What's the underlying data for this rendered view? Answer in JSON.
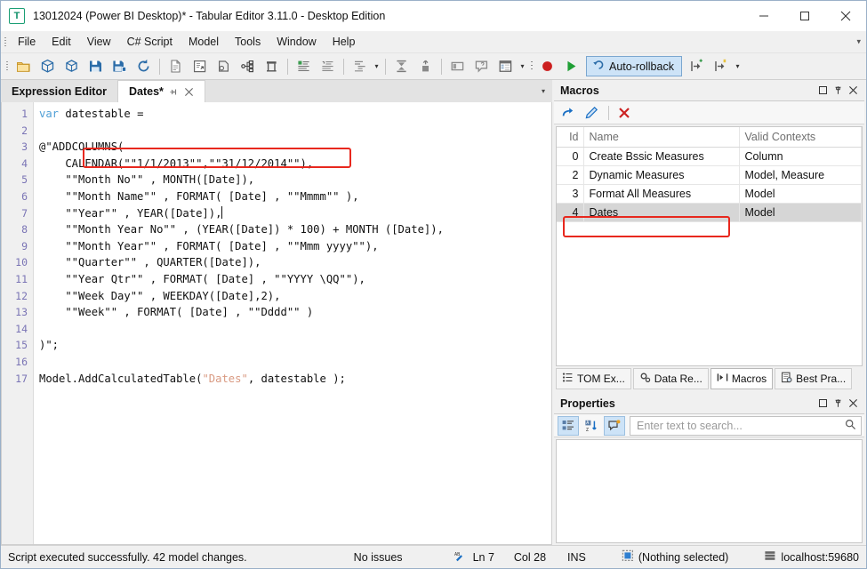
{
  "window": {
    "title": "13012024 (Power BI Desktop)* - Tabular Editor 3.11.0 - Desktop Edition",
    "app_icon": "tabular-editor-icon",
    "minimize_label": "–",
    "maximize_label": "□",
    "close_label": "✕"
  },
  "menubar": {
    "items": [
      {
        "label": "File"
      },
      {
        "label": "Edit"
      },
      {
        "label": "View"
      },
      {
        "label": "C# Script"
      },
      {
        "label": "Model"
      },
      {
        "label": "Tools"
      },
      {
        "label": "Window"
      },
      {
        "label": "Help"
      }
    ],
    "overflow_label": "▾"
  },
  "toolbar": {
    "groups": [
      {
        "buttons": [
          {
            "icon": "open-folder-icon",
            "label": "Open"
          },
          {
            "icon": "cube-open-icon",
            "label": "Open from Database"
          },
          {
            "icon": "cube-icon",
            "label": "Connect"
          },
          {
            "icon": "save-icon",
            "label": "Save"
          },
          {
            "icon": "save-as-icon",
            "label": "Save As"
          },
          {
            "icon": "refresh-icon",
            "label": "Refresh"
          }
        ]
      },
      {
        "buttons": [
          {
            "icon": "new-measure-icon",
            "label": "New Measure"
          },
          {
            "icon": "new-calculated-column-icon",
            "label": "New Calculated Column"
          },
          {
            "icon": "new-calculation-item-icon",
            "label": "New Calculation Item"
          },
          {
            "icon": "new-hierarchy-icon",
            "label": "New Hierarchy"
          },
          {
            "icon": "new-table-icon",
            "label": "New Table"
          }
        ]
      },
      {
        "buttons": [
          {
            "icon": "format-dax-icon",
            "label": "Format DAX"
          },
          {
            "icon": "format-dax-all-icon",
            "label": "Format All DAX"
          }
        ]
      },
      {
        "buttons": [
          {
            "icon": "align-icon",
            "label": "Align"
          }
        ],
        "caret": "▾"
      },
      {
        "buttons": [
          {
            "icon": "deploy-icon",
            "label": "Deploy"
          },
          {
            "icon": "refresh-table-icon",
            "label": "Refresh Table"
          }
        ]
      },
      {
        "buttons": [
          {
            "icon": "preview-icon",
            "label": "Preview Data"
          },
          {
            "icon": "query-icon",
            "label": "New DAX Query"
          },
          {
            "icon": "pivot-grid-icon",
            "label": "Pivot Grid"
          }
        ],
        "caret": "▾"
      },
      {
        "buttons": [
          {
            "icon": "record-macro-icon",
            "label": "Record Macro"
          },
          {
            "icon": "run-script-icon",
            "label": "Run Script"
          }
        ]
      }
    ],
    "rollback": {
      "icon": "undo-arrow-icon",
      "label": "Auto-rollback",
      "active": true
    },
    "step_buttons": [
      {
        "icon": "step-into-icon",
        "label": "Step Into"
      },
      {
        "icon": "step-over-icon",
        "label": "Step Over"
      }
    ],
    "step_caret": "▾"
  },
  "editor": {
    "tabs": [
      {
        "label": "Expression Editor",
        "type": "header",
        "active": false
      },
      {
        "label": "Dates*",
        "type": "document",
        "active": true,
        "pin_icon": "pin-icon",
        "close_icon": "close-icon"
      }
    ],
    "overflow_caret": "▾",
    "line_numbers": [
      1,
      2,
      3,
      4,
      5,
      6,
      7,
      8,
      9,
      10,
      11,
      12,
      13,
      14,
      15,
      16,
      17
    ],
    "lines": [
      "var datestable =",
      "",
      "@\"ADDCOLUMNS(",
      "    CALENDAR(\"\"1/1/2013\"\",\"\"31/12/2014\"\"),",
      "    \"\"Month No\"\" , MONTH([Date]),",
      "    \"\"Month Name\"\" , FORMAT( [Date] , \"\"Mmmm\"\" ),",
      "    \"\"Year\"\" , YEAR([Date]),",
      "    \"\"Month Year No\"\" , (YEAR([Date]) * 100) + MONTH ([Date]),",
      "    \"\"Month Year\"\" , FORMAT( [Date] , \"\"Mmm yyyy\"\"),",
      "    \"\"Quarter\"\" , QUARTER([Date]),",
      "    \"\"Year Qtr\"\" , FORMAT( [Date] , \"\"YYYY \\QQ\"\"),",
      "    \"\"Week Day\"\" , WEEKDAY([Date],2),",
      "    \"\"Week\"\" , FORMAT( [Date] , \"\"Dddd\"\" )",
      "",
      ")\";",
      "",
      "Model.AddCalculatedTable(\"Dates\", datestable );"
    ],
    "highlight_note": "red-annotation-box-around-calendar-call"
  },
  "macros_panel": {
    "title": "Macros",
    "window_buttons": [
      {
        "icon": "restore-icon",
        "label": "□"
      },
      {
        "icon": "pin-icon",
        "label": "⚲"
      },
      {
        "icon": "close-icon",
        "label": "✕"
      }
    ],
    "toolbar": [
      {
        "icon": "run-macro-icon",
        "label": "Run"
      },
      {
        "icon": "edit-macro-icon",
        "label": "Edit"
      },
      {
        "icon": "delete-macro-icon",
        "label": "Delete"
      }
    ],
    "columns": [
      "Id",
      "Name",
      "Valid Contexts"
    ],
    "rows": [
      {
        "id": "0",
        "name": "Create Bssic Measures",
        "contexts": "Column",
        "selected": false
      },
      {
        "id": "2",
        "name": "Dynamic Measures",
        "contexts": "Model, Measure",
        "selected": false
      },
      {
        "id": "3",
        "name": "Format All Measures",
        "contexts": "Model",
        "selected": false
      },
      {
        "id": "4",
        "name": "Dates",
        "contexts": "Model",
        "selected": true
      }
    ],
    "bottom_tabs": [
      {
        "label": "TOM Ex...",
        "icon": "tom-explorer-icon",
        "active": false
      },
      {
        "label": "Data Re...",
        "icon": "data-refresh-icon",
        "active": false
      },
      {
        "label": "Macros",
        "icon": "macros-icon",
        "active": true
      },
      {
        "label": "Best Pra...",
        "icon": "best-practice-icon",
        "active": false
      }
    ]
  },
  "properties_panel": {
    "title": "Properties",
    "window_buttons": [
      {
        "icon": "restore-icon",
        "label": "□"
      },
      {
        "icon": "pin-icon",
        "label": "⚲"
      },
      {
        "icon": "close-icon",
        "label": "✕"
      }
    ],
    "toolbar": [
      {
        "icon": "categorized-icon",
        "label": "Categorized",
        "selected": true
      },
      {
        "icon": "sort-az-icon",
        "label": "Alphabetical",
        "selected": false
      },
      {
        "icon": "property-pages-icon",
        "label": "Property Pages",
        "selected": true
      }
    ],
    "search_placeholder": "Enter text to search...",
    "search_value": "",
    "search_icon": "search-icon"
  },
  "statusbar": {
    "message": "Script executed successfully. 42 model changes.",
    "issues": "No issues",
    "caret_icon": "spellcheck-icon",
    "line": "Ln 7",
    "column": "Col 28",
    "insert_mode": "INS",
    "selection_icon": "selection-icon",
    "selection": "(Nothing selected)",
    "server_icon": "server-icon",
    "server": "localhost:59680"
  },
  "colors": {
    "accent_blue": "#1a6fc4",
    "annotation_red": "#e8281e",
    "selected_row": "#d6d6d6",
    "rollback_bg": "#cde3f7"
  }
}
